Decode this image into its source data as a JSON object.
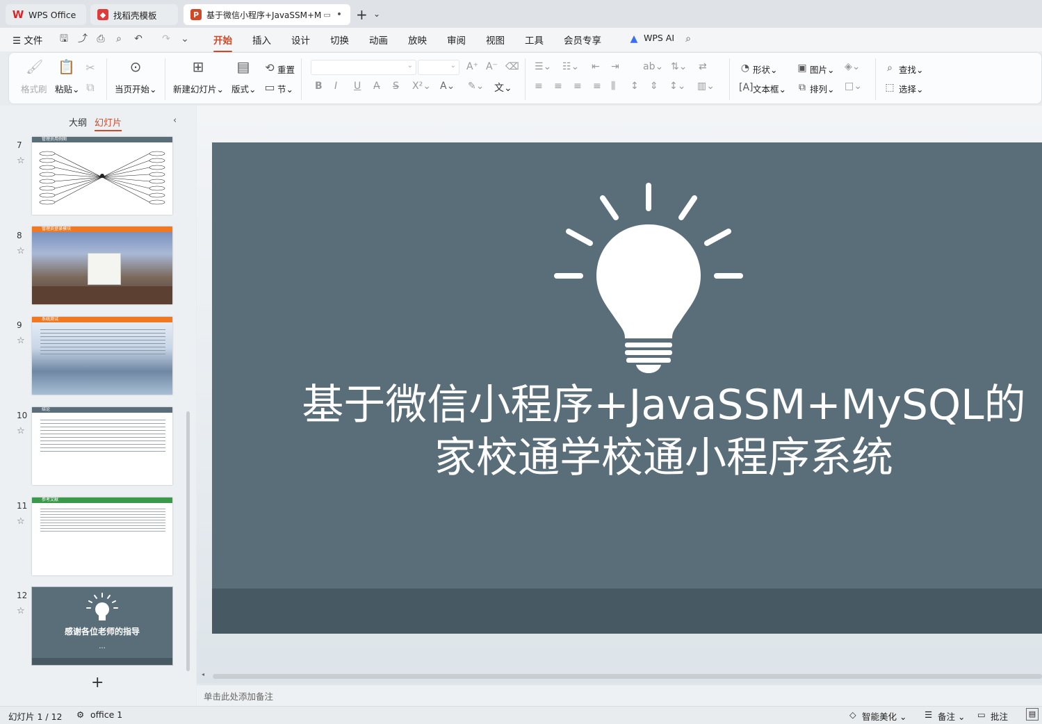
{
  "tabs": [
    {
      "label": "WPS Office",
      "icon": "wps-logo-icon"
    },
    {
      "label": "找稻壳模板",
      "icon": "docer-icon"
    },
    {
      "label": "基于微信小程序+JavaSSM+M",
      "icon": "ppt-file-icon"
    }
  ],
  "menu": {
    "file": "文件",
    "items": [
      "开始",
      "插入",
      "设计",
      "切换",
      "动画",
      "放映",
      "审阅",
      "视图",
      "工具",
      "会员专享"
    ],
    "active": "开始",
    "wps_ai": "WPS AI"
  },
  "ribbon": {
    "format_painter": "格式刷",
    "paste": "粘贴",
    "play_from_current": "当页开始",
    "new_slide": "新建幻灯片",
    "layout": "版式",
    "reset": "重置",
    "section": "节",
    "shape": "形状",
    "picture": "图片",
    "textbox": "文本框",
    "arrange": "排列",
    "find": "查找",
    "select": "选择"
  },
  "left_panel": {
    "tab_outline": "大纲",
    "tab_slides": "幻灯片",
    "slides": [
      {
        "num": "7",
        "header": "管理员用例图"
      },
      {
        "num": "8",
        "header": "管理员登录模块"
      },
      {
        "num": "9",
        "header": "系统测试"
      },
      {
        "num": "10",
        "header": "结论"
      },
      {
        "num": "11",
        "header": "参考文献"
      },
      {
        "num": "12",
        "title": "感谢各位老师的指导",
        "dots": "..."
      }
    ]
  },
  "slide": {
    "title_line1": "基于微信小程序+JavaSSM+MySQL的",
    "title_line2": "家校通学校通小程序系统"
  },
  "notes_placeholder": "单击此处添加备注",
  "status": {
    "slide_counter": "幻灯片 1 / 12",
    "theme": "office 1",
    "smart_beautify": "智能美化",
    "notes": "备注",
    "comments": "批注"
  },
  "colors": {
    "accent": "#d24726",
    "slide_bg": "#5a6e7a",
    "slide_footer": "#475963",
    "orange_header": "#f07820",
    "green_header": "#3a9a4a",
    "gray_header": "#5a6e7a"
  }
}
